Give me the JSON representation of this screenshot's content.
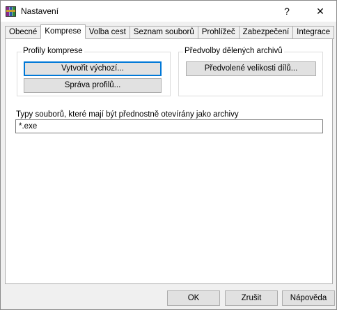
{
  "window": {
    "title": "Nastavení"
  },
  "titlebar": {
    "help_glyph": "?",
    "close_glyph": "✕"
  },
  "tabs": [
    {
      "label": "Obecné"
    },
    {
      "label": "Komprese",
      "active": true
    },
    {
      "label": "Volba cest"
    },
    {
      "label": "Seznam souborů"
    },
    {
      "label": "Prohlížeč"
    },
    {
      "label": "Zabezpečení"
    },
    {
      "label": "Integrace"
    }
  ],
  "compression_profiles": {
    "legend": "Profily komprese",
    "create_default_label": "Vytvořit výchozí...",
    "manage_profiles_label": "Správa profilů..."
  },
  "split_archives": {
    "legend": "Předvolby dělených archivů",
    "predefined_sizes_label": "Předvolené velikosti dílů..."
  },
  "file_types": {
    "label": "Typy souborů, které mají být přednostně otevírány jako archivy",
    "value": "*.exe"
  },
  "footer": {
    "ok_label": "OK",
    "cancel_label": "Zrušit",
    "help_label": "Nápověda"
  }
}
